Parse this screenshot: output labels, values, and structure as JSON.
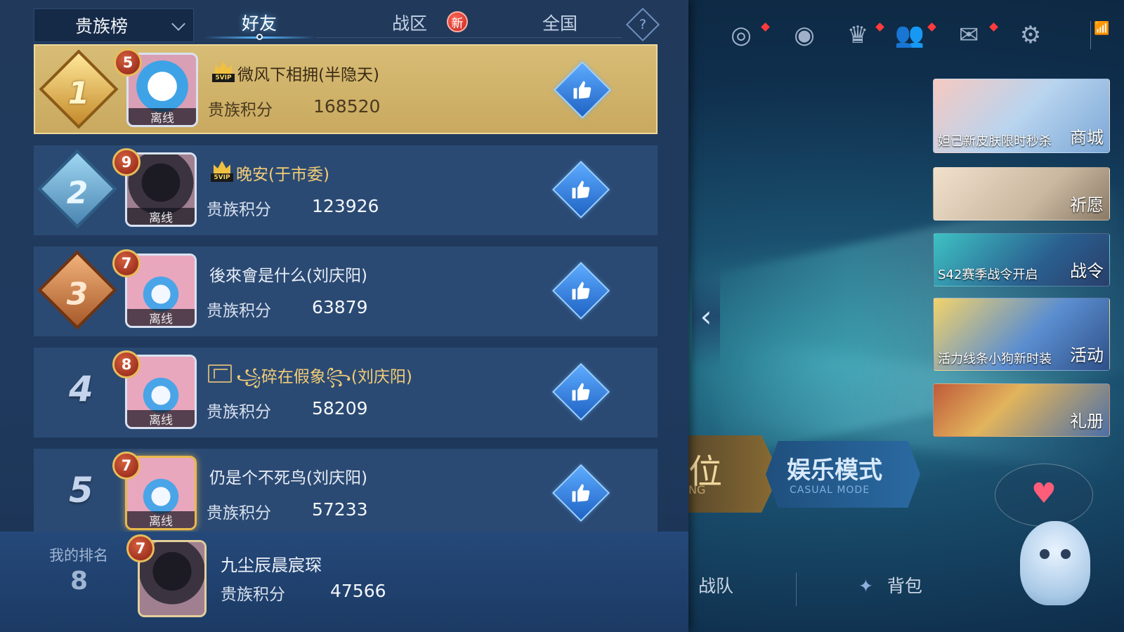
{
  "leaderboard": {
    "dropdown_label": "贵族榜",
    "tabs": [
      {
        "label": "好友",
        "active": true
      },
      {
        "label": "战区",
        "badge": "新"
      },
      {
        "label": "全国"
      }
    ],
    "help_label": "?",
    "entries": [
      {
        "rank": "1",
        "level": "5",
        "status": "离线",
        "name": "微风下相拥(半隐天)",
        "score_label": "贵族积分",
        "score": "168520",
        "vip": true
      },
      {
        "rank": "2",
        "level": "9",
        "status": "离线",
        "name": "晚安(于市委)",
        "score_label": "贵族积分",
        "score": "123926",
        "vip": true
      },
      {
        "rank": "3",
        "level": "7",
        "status": "离线",
        "name": "後來會是什么(刘庆阳)",
        "score_label": "贵族积分",
        "score": "63879",
        "vip": false
      },
      {
        "rank": "4",
        "level": "8",
        "status": "离线",
        "name": "꧁碎在假象꧂(刘庆阳)",
        "score_label": "贵族积分",
        "score": "58209",
        "vip": false
      },
      {
        "rank": "5",
        "level": "7",
        "status": "离线",
        "name": "仍是个不死鸟(刘庆阳)",
        "score_label": "贵族积分",
        "score": "57233",
        "vip": false
      }
    ],
    "vip_tag": "5VIP",
    "my_rank": {
      "label": "我的排名",
      "rank": "8",
      "level": "7",
      "name": "九尘辰晨宸琛",
      "score_label": "贵族积分",
      "score": "47566"
    }
  },
  "hud": {
    "icons": [
      "target-icon",
      "eye-icon",
      "trophy-icon",
      "friends-icon",
      "mail-icon",
      "gear-icon"
    ]
  },
  "banners": [
    {
      "text": "妲己新皮肤限时秒杀",
      "side": "商城"
    },
    {
      "text": "",
      "side": "祈愿"
    },
    {
      "text": "S42赛季战令开启",
      "side": "战令"
    },
    {
      "text": "活力线条小狗新时装",
      "side": "活动"
    },
    {
      "text": "",
      "side": "礼册"
    }
  ],
  "modes": {
    "left_text": "位",
    "left_sub": "NG",
    "right_title": "娱乐模式",
    "right_sub": "CASUAL MODE"
  },
  "bottom": {
    "team": "战队",
    "bag": "背包"
  },
  "colors": {
    "panel": "#213a5c",
    "first_row": "#d8bd76",
    "row": "#2b4a73",
    "accent_blue": "#59b8ff",
    "badge_red": "#c4231d"
  }
}
